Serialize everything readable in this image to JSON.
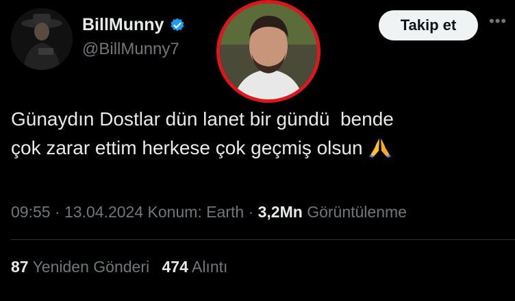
{
  "author": {
    "display_name": "BillMunny",
    "handle": "@BillMunny7",
    "verified": true,
    "verified_color": "#1d9bf0"
  },
  "actions": {
    "follow_label": "Takip et",
    "more_label": "•••"
  },
  "tweet": {
    "text": "Günaydın Dostlar dün lanet bir gündü  bende\nçok zarar ettim herkese çok geçmiş olsun",
    "emoji": "folded-hands-icon"
  },
  "meta": {
    "time": "09:55",
    "date": "13.04.2024",
    "location": "Konum: Earth",
    "separator": "·",
    "views_count": "3,2Mn",
    "views_label": "Görüntülenme"
  },
  "stats": {
    "reposts_count": "87",
    "reposts_label": "Yeniden Gönderi",
    "quotes_count": "474",
    "quotes_label": "Alıntı"
  },
  "colors": {
    "background": "#000000",
    "text": "#e7e9ea",
    "secondary": "#71767b",
    "badge_ring": "#e0161b"
  }
}
